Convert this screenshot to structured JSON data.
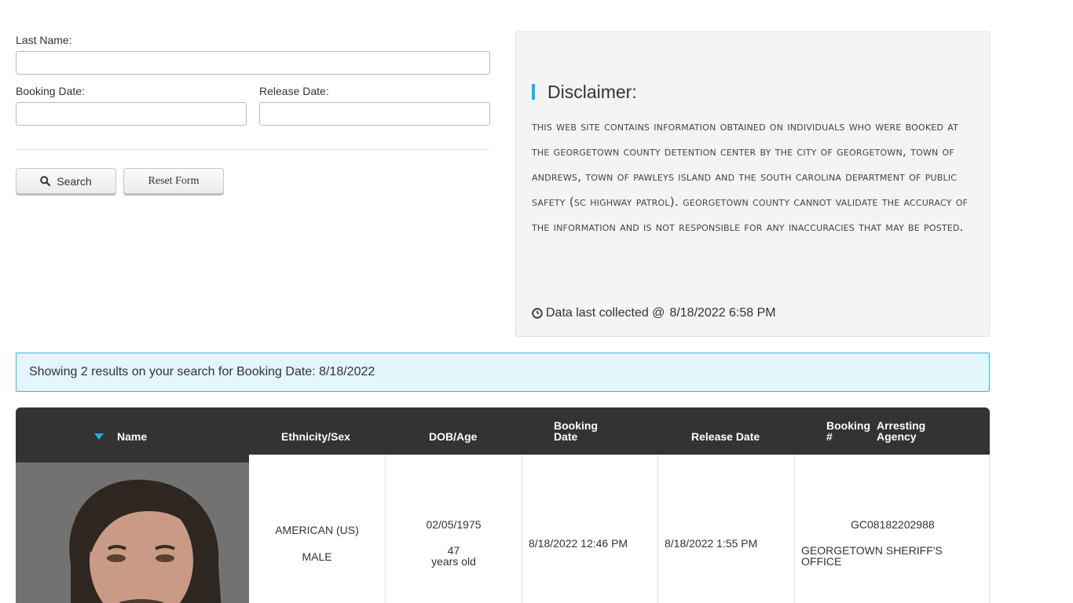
{
  "form": {
    "last_name_label": "Last Name:",
    "last_name_value": "",
    "booking_date_label": "Booking Date:",
    "booking_date_value": "",
    "release_date_label": "Release Date:",
    "release_date_value": "",
    "search_label": "Search",
    "reset_label": "Reset Form"
  },
  "disclaimer": {
    "title": "Disclaimer:",
    "body": "This web site contains information obtained on individuals who were booked at the Georgetown County Detention Center by the City of Georgetown, Town of Andrews, Town of Pawleys Island and the South Carolina Department of Public Safety (SC Highway Patrol). Georgetown County cannot validate the accuracy of the information and is not responsible for any inaccuracies that may be posted.",
    "collected_label": "Data last collected @",
    "collected_value": "8/18/2022 6:58 PM"
  },
  "results": {
    "message": "Showing 2 results on your search for Booking Date: 8/18/2022"
  },
  "table": {
    "headers": {
      "name": "Name",
      "ethnicity_sex": "Ethnicity/Sex",
      "dob_age": "DOB/Age",
      "booking_date_1": "Booking",
      "booking_date_2": "Date",
      "release_date": "Release Date",
      "booking_num_1": "Booking",
      "booking_num_2": "#",
      "arresting_1": "Arresting",
      "arresting_2": "Agency"
    },
    "rows": [
      {
        "ethnicity": "AMERICAN (US)",
        "sex": "MALE",
        "dob": "02/05/1975",
        "age": "47",
        "age_suffix": "years old",
        "booking_date": "8/18/2022 12:46 PM",
        "release_date": "8/18/2022 1:55 PM",
        "booking_number": "GC08182202988",
        "agency_line1": "GEORGETOWN SHERIFF'S",
        "agency_line2": "OFFICE"
      }
    ]
  },
  "colors": {
    "accent": "#1ab0e6",
    "header_bg": "#333333",
    "alert_bg": "#e2f6fb",
    "alert_border": "#2bbfd9"
  }
}
